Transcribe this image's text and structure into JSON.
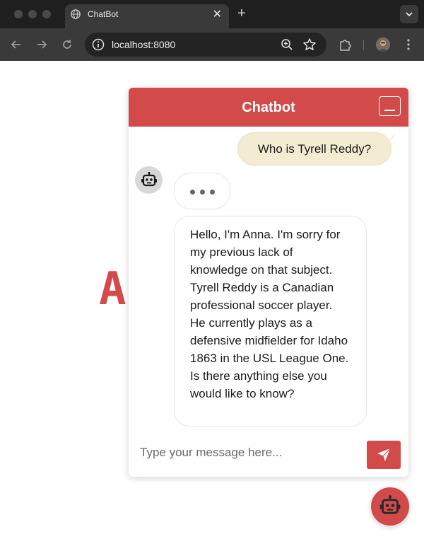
{
  "browser": {
    "tab_title": "ChatBot",
    "tab_close": "✕",
    "new_tab": "+",
    "url": "localhost:8080",
    "tab_favicon": "globe-icon",
    "colors": {
      "tabbar": "#1f1f1f",
      "toolbar": "#3a3a3a",
      "omnibox": "#232323"
    }
  },
  "page": {
    "background_heading": "A",
    "accent_color": "#d24a4a"
  },
  "chatbot": {
    "title": "Chatbot",
    "messages": [
      {
        "sender": "user",
        "text": "Who is Tyrell Reddy?"
      },
      {
        "sender": "bot",
        "typing": true
      },
      {
        "sender": "bot",
        "text": "Hello, I'm Anna. I'm sorry for my previous lack of knowledge on that subject. Tyrell Reddy is a Canadian professional soccer player. He currently plays as a defensive midfielder for Idaho 1863 in the USL League One. Is there anything else you would like to know?"
      }
    ],
    "input": {
      "placeholder": "Type your message here...",
      "value": ""
    },
    "colors": {
      "header": "#d24a4a",
      "user_bubble": "#f3ecd2",
      "bot_avatar_bg": "#d8d8d8"
    }
  }
}
